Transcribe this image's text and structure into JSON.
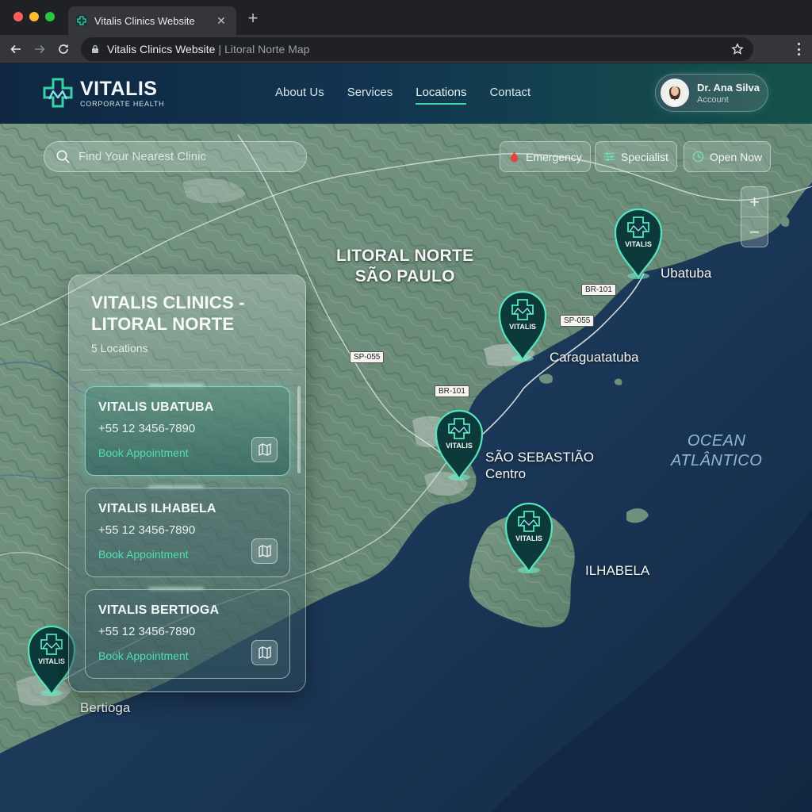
{
  "browser": {
    "tab_title": "Vitalis Clinics Website",
    "close_glyph": "✕",
    "newtab_glyph": "+",
    "url_host": "Vitalis Clinics Website",
    "url_sep": "|",
    "url_path": "Litoral Norte Map"
  },
  "header": {
    "brand_name": "VITALIS",
    "brand_tagline": "CORPORATE HEALTH",
    "nav": [
      {
        "label": "About Us"
      },
      {
        "label": "Services"
      },
      {
        "label": "Locations"
      },
      {
        "label": "Contact"
      }
    ],
    "active_nav": "Locations",
    "account": {
      "name": "Dr. Ana Silva",
      "role": "Account"
    }
  },
  "search": {
    "placeholder": "Find Your Nearest Clinic",
    "value": ""
  },
  "filters": [
    {
      "label": "Emergency",
      "icon": "drop-icon"
    },
    {
      "label": "Specialist",
      "icon": "sliders-icon"
    },
    {
      "label": "Open Now",
      "icon": "clock-icon"
    }
  ],
  "zoom": {
    "in": "+",
    "out": "−"
  },
  "map": {
    "region_line1": "LITORAL NORTE",
    "region_line2": "SÃO PAULO",
    "ocean_line1": "OCEAN",
    "ocean_line2": "ATLÂNTICO",
    "cities": {
      "ubatuba": "Ubatuba",
      "caraguatatuba": "Caraguatatuba",
      "sao_sebastiao_1": "SÃO SEBASTIÃO",
      "sao_sebastiao_2": "Centro",
      "ilhabela": "ILHABELA",
      "bertioga": "Bertioga"
    },
    "roads": {
      "br101_a": "BR-101",
      "sp055_a": "SP-055",
      "sp055_b": "SP-055",
      "br101_b": "BR-101"
    },
    "pin_label": "VITALIS"
  },
  "panel": {
    "title_line1": "VITALIS CLINICS -",
    "title_line2": "LITORAL NORTE",
    "count": "5 Locations",
    "clinics": [
      {
        "name": "VITALIS UBATUBA",
        "phone": "+55 12 3456-7890",
        "action": "Book Appointment"
      },
      {
        "name": "VITALIS ILHABELA",
        "phone": "+55 12 3456-7890",
        "action": "Book Appointment"
      },
      {
        "name": "VITALIS BERTIOGA",
        "phone": "+55 12 3456-7890",
        "action": "Book Appointment"
      }
    ]
  },
  "colors": {
    "accent": "#35d3a6",
    "header_start": "#0f2742",
    "header_end": "#15524a",
    "land": "#6e8f7c",
    "ocean": "#1a3553",
    "pin_fill": "#0c3a3a"
  }
}
